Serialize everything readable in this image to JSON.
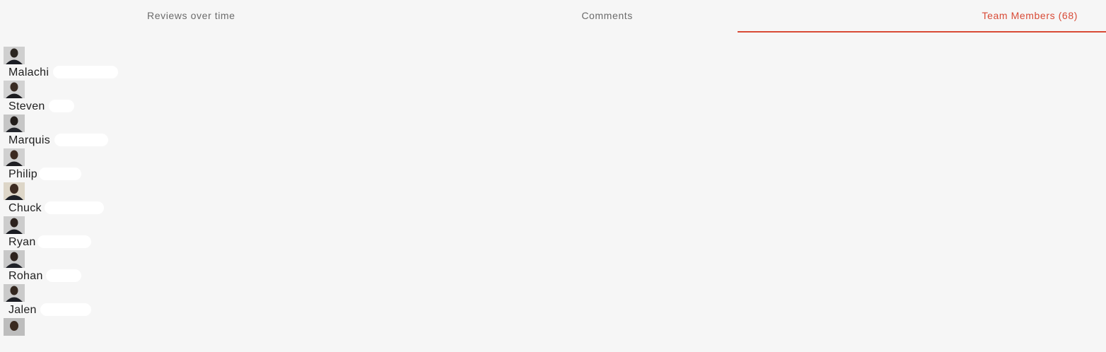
{
  "tabs": [
    {
      "label": "Reviews over time",
      "active": false
    },
    {
      "label": "Comments",
      "active": false
    },
    {
      "label": "Team Members (68)",
      "active": true
    }
  ],
  "colors": {
    "accent": "#d84a36",
    "background": "#f6f6f6",
    "tab_text": "#6b6b6b"
  },
  "members": [
    {
      "name": "Malachi",
      "avatar_icon": "person-avatar-icon"
    },
    {
      "name": "Steven",
      "avatar_icon": "person-avatar-icon"
    },
    {
      "name": "Marquis",
      "avatar_icon": "person-avatar-icon"
    },
    {
      "name": "Philip",
      "avatar_icon": "person-avatar-icon"
    },
    {
      "name": "Chuck",
      "avatar_icon": "person-avatar-icon"
    },
    {
      "name": "Ryan",
      "avatar_icon": "person-avatar-icon"
    },
    {
      "name": "Rohan",
      "avatar_icon": "person-avatar-icon"
    },
    {
      "name": "Jalen",
      "avatar_icon": "person-avatar-icon"
    },
    {
      "name": "",
      "avatar_icon": "person-avatar-icon"
    }
  ]
}
